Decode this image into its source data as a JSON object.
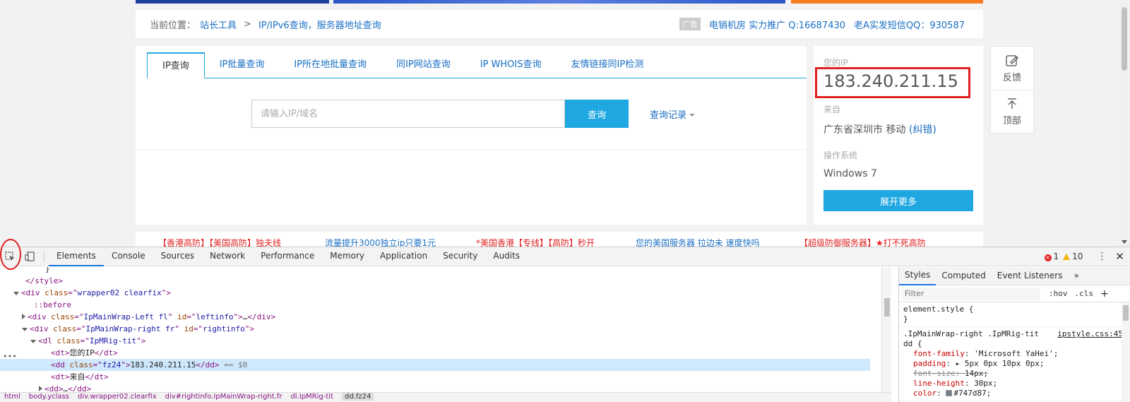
{
  "breadcrumb": {
    "current_label": "当前位置：",
    "link1": "站长工具",
    "separator": ">",
    "link2": "IP/IPv6查询，服务器地址查询",
    "ad_tag": "广告",
    "ad_red": "电销机房 实力推广 Q:16687430",
    "ad_blue": "老A实发短信QQ：930587"
  },
  "tabs": [
    {
      "label": "IP查询",
      "active": true
    },
    {
      "label": "IP批量查询",
      "active": false
    },
    {
      "label": "IP所在地批量查询",
      "active": false
    },
    {
      "label": "同IP网站查询",
      "active": false
    },
    {
      "label": "IP WHOIS查询",
      "active": false
    },
    {
      "label": "友情链接同IP检测",
      "active": false
    }
  ],
  "query": {
    "placeholder": "请输入IP/域名",
    "button": "查询",
    "history": "查询记录"
  },
  "info": {
    "ip_label": "您的IP",
    "ip_value": "183.240.211.15",
    "from_label": "来自",
    "location": "广东省深圳市 移动",
    "correct_link": "(纠错)",
    "os_label": "操作系统",
    "os_value": "Windows 7",
    "more_button": "展开更多"
  },
  "side_float": {
    "feedback": "反馈",
    "top": "顶部"
  },
  "ad_strip": [
    {
      "text": "【香港高防】【美国高防】独夫线",
      "color": "red"
    },
    {
      "text": "流量提升3000独立ip只要1元",
      "color": "blue"
    },
    {
      "text": "*美国香港【专线】【高防】秒开",
      "color": "red"
    },
    {
      "text": "您的美国服务器 拉边未 速度快吗",
      "color": "blue"
    },
    {
      "text": "【超级防御服务器】★打不死高防",
      "color": "red"
    }
  ],
  "devtools": {
    "tabs": [
      "Elements",
      "Console",
      "Sources",
      "Network",
      "Performance",
      "Memory",
      "Application",
      "Security",
      "Audits"
    ],
    "active_tab": "Elements",
    "errors": "1",
    "warnings": "10",
    "dom_lines": [
      {
        "indent": 64,
        "tri": "",
        "html": "<span class=\"txt\">}</span>"
      },
      {
        "indent": 36,
        "tri": "",
        "html": "<span class=\"tag\">&lt;/style&gt;</span>"
      },
      {
        "indent": 28,
        "tri": "open",
        "html": "<span class=\"tag\">&lt;div </span><span class=\"an\">class</span><span class=\"tag\">=\"</span><span class=\"av\">wrapper02 clearfix</span><span class=\"tag\">\"&gt;</span>"
      },
      {
        "indent": 48,
        "tri": "",
        "html": "<span class=\"pseudo\">::before</span>"
      },
      {
        "indent": 40,
        "tri": "closed",
        "html": "<span class=\"tag\">&lt;div </span><span class=\"an\">class</span><span class=\"tag\">=\"</span><span class=\"av\">IpMainWrap-Left fl</span><span class=\"tag\">\" </span><span class=\"an\">id</span><span class=\"tag\">=\"</span><span class=\"av\">leftinfo</span><span class=\"tag\">\"&gt;</span><span class=\"txt\">…</span><span class=\"tag\">&lt;/div&gt;</span>"
      },
      {
        "indent": 40,
        "tri": "open",
        "html": "<span class=\"tag\">&lt;div </span><span class=\"an\">class</span><span class=\"tag\">=\"</span><span class=\"av\">IpMainWrap-right fr</span><span class=\"tag\">\" </span><span class=\"an\">id</span><span class=\"tag\">=\"</span><span class=\"av\">rightinfo</span><span class=\"tag\">\"&gt;</span>"
      },
      {
        "indent": 52,
        "tri": "open",
        "html": "<span class=\"tag\">&lt;dl </span><span class=\"an\">class</span><span class=\"tag\">=\"</span><span class=\"av\">IpMRig-tit</span><span class=\"tag\">\"&gt;</span>"
      },
      {
        "indent": 72,
        "tri": "",
        "html": "<span class=\"tag\">&lt;dt&gt;</span><span class=\"txt\">您的IP</span><span class=\"tag\">&lt;/dt&gt;</span>"
      },
      {
        "indent": 72,
        "tri": "",
        "selected": true,
        "html": "<span class=\"tag\">&lt;dd </span><span class=\"an\">class</span><span class=\"tag\">=\"</span><span class=\"av\">fz24</span><span class=\"tag\">\"&gt;</span><span class=\"txt\">183.240.211.15</span><span class=\"tag\">&lt;/dd&gt;</span><span class=\"dollar\"> == $0</span>"
      },
      {
        "indent": 72,
        "tri": "",
        "html": "<span class=\"tag\">&lt;dt&gt;</span><span class=\"txt\">来自</span><span class=\"tag\">&lt;/dt&gt;</span>"
      },
      {
        "indent": 64,
        "tri": "closed",
        "html": "<span class=\"tag\">&lt;dd&gt;</span><span class=\"txt\">…</span><span class=\"tag\">&lt;/dd&gt;</span>"
      }
    ],
    "crumbs": [
      "html",
      "body.yclass",
      "div.wrapper02.clearfix",
      "div#rightinfo.IpMainWrap-right.fr",
      "dl.IpMRig-tit"
    ],
    "crumb_current": "dd.fz24",
    "styles_tabs": [
      "Styles",
      "Computed",
      "Event Listeners"
    ],
    "styles_more": "»",
    "filter_placeholder": "Filter",
    "hov": ":hov",
    "cls": ".cls",
    "plus": "+",
    "element_style": "element.style {",
    "element_style_close": "}",
    "rule_selector_1": ".IpMainWrap-right .IpMRig-tit",
    "rule_selector_2": "dd {",
    "rule_source": "ipstyle.css:45",
    "decls": [
      {
        "name": "font-family",
        "value": "'Microsoft YaHei';",
        "struck": false
      },
      {
        "name": "padding",
        "value": "▸ 5px 0px 10px 0px;",
        "struck": false
      },
      {
        "name": "font-size",
        "value": "14px;",
        "struck": true
      },
      {
        "name": "line-height",
        "value": "30px;",
        "struck": false
      },
      {
        "name": "color",
        "value": "#747d87;",
        "struck": false,
        "swatch": true
      }
    ]
  }
}
